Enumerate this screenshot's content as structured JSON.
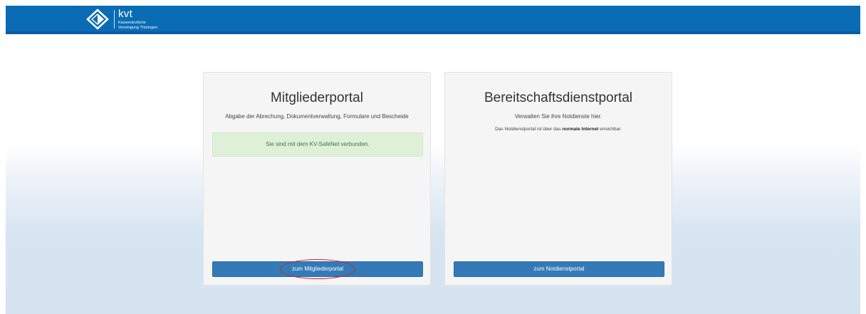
{
  "header": {
    "logo_name": "kvt",
    "logo_subtitle_line1": "Kassenärztliche",
    "logo_subtitle_line2": "Vereinigung Thüringen",
    "bar_color": "#0a6cb5"
  },
  "cards": {
    "member": {
      "title": "Mitgliederportal",
      "subtitle": "Abgabe der Abrechung, Dokumentverwaltung, Formulare und Bescheide",
      "alert": "Sie sind mit dem KV-SafeNet verbunden.",
      "button": "zum Mitgliederportal"
    },
    "standby": {
      "title": "Bereitschaftsdienstportal",
      "subtitle": "Verwalten Sie ihre Notdienste hier.",
      "note_before": "Das Notdienstportal ist über das ",
      "note_bold": "normale Internet",
      "note_after": " erreichbar.",
      "button": "zum Notdienstportal"
    }
  },
  "colors": {
    "primary_button": "#337ab7",
    "success_bg": "#dff0d8",
    "success_text": "#3c763d",
    "annotation_ring": "#d0202a"
  },
  "icons": [
    "kvt-logo-icon"
  ]
}
